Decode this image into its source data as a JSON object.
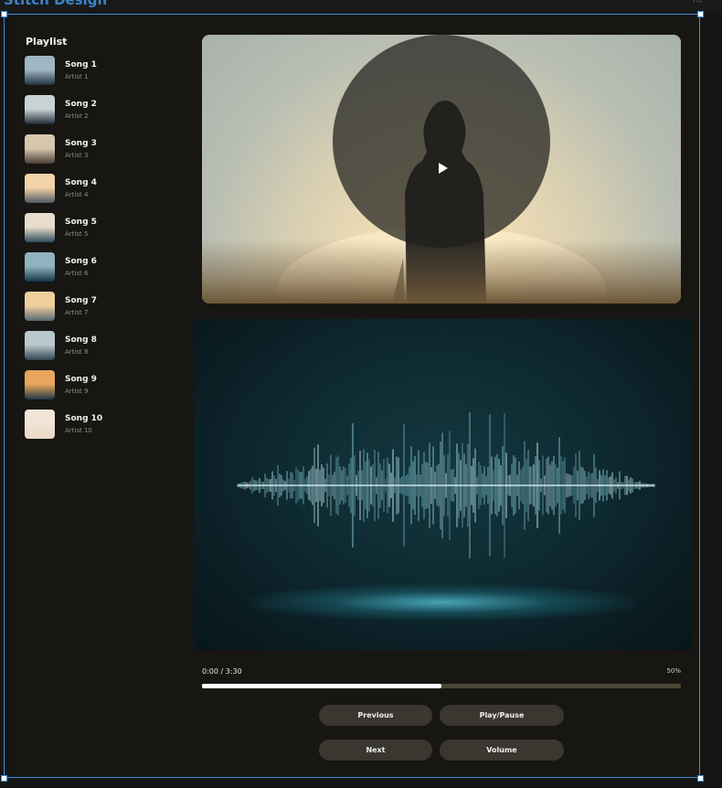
{
  "editor": {
    "brand": "Stitch Design",
    "control": "…"
  },
  "playlist": {
    "title": "Playlist",
    "songs": [
      {
        "title": "Song 1",
        "artist": "Artist 1",
        "colors": [
          "#9fb6c3",
          "#22323e"
        ]
      },
      {
        "title": "Song 2",
        "artist": "Artist 2",
        "colors": [
          "#c9d3d6",
          "#1d2a33"
        ]
      },
      {
        "title": "Song 3",
        "artist": "Artist 3",
        "colors": [
          "#d6c7ab",
          "#4a3d33"
        ]
      },
      {
        "title": "Song 4",
        "artist": "Artist 4",
        "colors": [
          "#f3d3a8",
          "#4d5863"
        ]
      },
      {
        "title": "Song 5",
        "artist": "Artist 5",
        "colors": [
          "#e7ddca",
          "#2e4c5a"
        ]
      },
      {
        "title": "Song 6",
        "artist": "Artist 6",
        "colors": [
          "#8fb3bf",
          "#143548"
        ]
      },
      {
        "title": "Song 7",
        "artist": "Artist 7",
        "colors": [
          "#f0cf9d",
          "#5a6773"
        ]
      },
      {
        "title": "Song 8",
        "artist": "Artist 8",
        "colors": [
          "#b9c8cc",
          "#2f4450"
        ]
      },
      {
        "title": "Song 9",
        "artist": "Artist 9",
        "colors": [
          "#e9a55c",
          "#1e3744"
        ]
      },
      {
        "title": "Song 10",
        "artist": "Artist 10",
        "colors": [
          "#f1e4d8",
          "#e9d5c4"
        ]
      }
    ]
  },
  "player": {
    "time": "0:00 / 3:30",
    "volume": "50%",
    "progress": 0.5
  },
  "controls": {
    "previous": "Previous",
    "play_pause": "Play/Pause",
    "next": "Next",
    "volume": "Volume"
  },
  "colors": {
    "accent_selection": "#3d8fd6",
    "background": "#171612",
    "button": "#3a3730",
    "track": "#4b4634"
  }
}
